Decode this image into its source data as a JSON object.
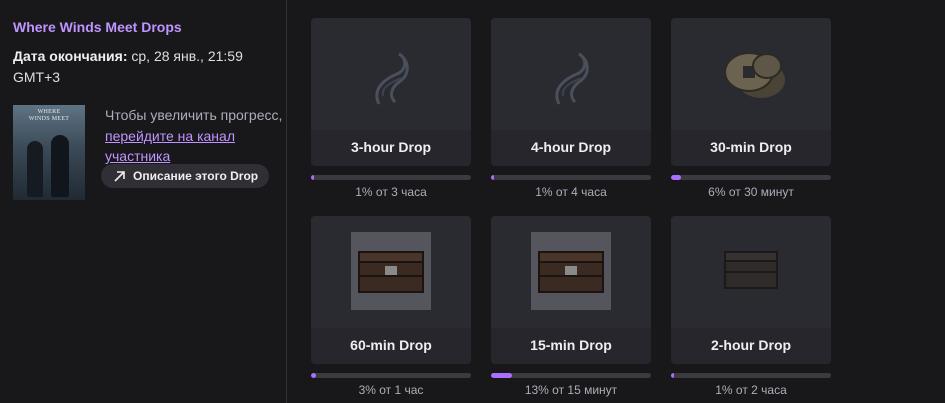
{
  "campaign": {
    "title": "Where Winds Meet Drops",
    "end_label": "Дата окончания:",
    "end_value": "ср, 28 янв., 21:59 GMT+3",
    "cover_logo": "WHERE WINDS MEET",
    "progress_text": "Чтобы увеличить прогресс,",
    "progress_link": "перейдите на канал участника",
    "description_button": "Описание этого Drop"
  },
  "drops": [
    {
      "name": "3-hour Drop",
      "progress_text": "1% от 3 часа",
      "progress": 0.01,
      "icon": "swirl-emblem-icon"
    },
    {
      "name": "4-hour Drop",
      "progress_text": "1% от 4 часа",
      "progress": 0.01,
      "icon": "swirl-emblem-icon"
    },
    {
      "name": "30-min Drop",
      "progress_text": "6% от 30 минут",
      "progress": 0.06,
      "icon": "coins-icon"
    },
    {
      "name": "60-min Drop",
      "progress_text": "3% от 1 час",
      "progress": 0.03,
      "icon": "chest-icon"
    },
    {
      "name": "15-min Drop",
      "progress_text": "13% от 15 минут",
      "progress": 0.13,
      "icon": "chest-icon"
    },
    {
      "name": "2-hour Drop",
      "progress_text": "1% от 2 часа",
      "progress": 0.01,
      "icon": "dark-chest-icon"
    }
  ],
  "colors": {
    "accent": "#bf94ff",
    "progress_fill": "#a970ff",
    "background": "#18181b",
    "card": "#26262c"
  }
}
